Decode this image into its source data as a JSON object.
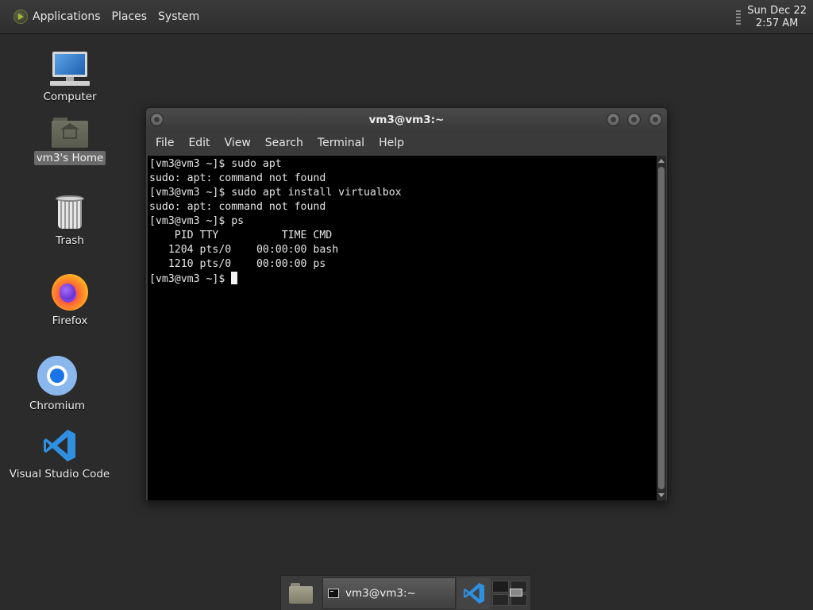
{
  "top_panel": {
    "menus": [
      "Applications",
      "Places",
      "System"
    ],
    "clock_date": "Sun Dec 22",
    "clock_time": "2:57 AM"
  },
  "desktop": {
    "icons": [
      {
        "label": "Computer",
        "icon": "computer-icon"
      },
      {
        "label": "vm3's Home",
        "icon": "home-folder-icon",
        "selected": true
      },
      {
        "label": "Trash",
        "icon": "trash-icon"
      },
      {
        "label": "Firefox",
        "icon": "firefox-icon"
      },
      {
        "label": "Chromium",
        "icon": "chromium-icon"
      },
      {
        "label": "Visual Studio Code",
        "icon": "vscode-icon"
      }
    ]
  },
  "terminal": {
    "title": "vm3@vm3:~",
    "menu": [
      "File",
      "Edit",
      "View",
      "Search",
      "Terminal",
      "Help"
    ],
    "lines": [
      "[vm3@vm3 ~]$ sudo apt",
      "sudo: apt: command not found",
      "[vm3@vm3 ~]$ sudo apt install virtualbox",
      "sudo: apt: command not found",
      "[vm3@vm3 ~]$ ps",
      "    PID TTY          TIME CMD",
      "   1204 pts/0    00:00:00 bash",
      "   1210 pts/0    00:00:00 ps"
    ],
    "prompt": "[vm3@vm3 ~]$ "
  },
  "taskbar": {
    "task_label": "vm3@vm3:~"
  },
  "colors": {
    "desktop_bg": "#2b2b2b",
    "terminal_bg": "#000000",
    "vscode_blue": "#2f8fe0"
  }
}
